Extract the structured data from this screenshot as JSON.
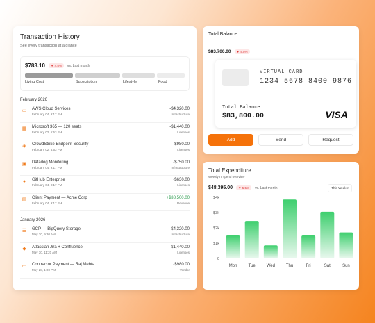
{
  "transaction_history": {
    "title": "Transaction History",
    "subtitle": "See every transaction at a glance",
    "summary": {
      "amount": "$783.10",
      "change": "▼ 4.5%",
      "comparison": "vs. Last month",
      "categories": [
        "Living Cost",
        "Subscription",
        "Lifestyle",
        "Food"
      ]
    },
    "groups": [
      {
        "month": "February 2026",
        "items": [
          {
            "icon": "server-icon",
            "glyph": "▭",
            "name": "AWS Cloud Services",
            "date": "February 04, 9:17 PM",
            "amount": "-$4,320.00",
            "category": "Infrastructure",
            "positive": false
          },
          {
            "icon": "apps-icon",
            "glyph": "▦",
            "name": "Microsoft 365 — 120 seats",
            "date": "February 02, 6:53 PM",
            "amount": "-$1,440.00",
            "category": "Licenses",
            "positive": false
          },
          {
            "icon": "shield-icon",
            "glyph": "◈",
            "name": "CrowdStrike Endpoint Security",
            "date": "February 02, 6:53 PM",
            "amount": "-$980.00",
            "category": "Licenses",
            "positive": false
          },
          {
            "icon": "monitor-icon",
            "glyph": "▣",
            "name": "Datadog Monitoring",
            "date": "February 04, 9:17 PM",
            "amount": "-$750.00",
            "category": "Infrastructure",
            "positive": false
          },
          {
            "icon": "github-icon",
            "glyph": "●",
            "name": "GitHub Enterprise",
            "date": "February 04, 9:17 PM",
            "amount": "-$630.00",
            "category": "Licenses",
            "positive": false
          },
          {
            "icon": "invoice-icon",
            "glyph": "▤",
            "name": "Client Payment — Acme Corp",
            "date": "February 04, 9:17 PM",
            "amount": "+$38,500.00",
            "category": "Revenue",
            "positive": true
          }
        ]
      },
      {
        "month": "January 2026",
        "items": [
          {
            "icon": "database-icon",
            "glyph": "☰",
            "name": "GCP — BigQuery Storage",
            "date": "May 30, 9:30 AM",
            "amount": "-$4,320.00",
            "category": "Infrastructure",
            "positive": false
          },
          {
            "icon": "layers-icon",
            "glyph": "◆",
            "name": "Atlassian Jira + Confluence",
            "date": "May 30, 11:20 AM",
            "amount": "-$1,440.00",
            "category": "Licenses",
            "positive": false
          },
          {
            "icon": "payment-icon",
            "glyph": "▭",
            "name": "Contractor Payment — Raj Mehta",
            "date": "May 28, 1:00 PM",
            "amount": "-$980.00",
            "category": "Vendor",
            "positive": false
          }
        ]
      }
    ]
  },
  "total_balance": {
    "title": "Total Balance",
    "amount": "$83,700.00",
    "change": "▼ 4.5%",
    "card": {
      "label": "VIRTUAL CARD",
      "number": "1234 5678 8400 9876",
      "balance_label": "Total Balance",
      "balance": "$83,800.00",
      "brand": "VISA"
    },
    "buttons": {
      "add": "Add",
      "send": "Send",
      "request": "Request"
    }
  },
  "total_expenditure": {
    "title": "Total Expenditure",
    "subtitle": "Weekly IT spend overview",
    "amount": "$48,395.00",
    "change": "▼ 5.5%",
    "comparison": "vs. Last month",
    "range_select": "This Week ▾"
  },
  "colors": {
    "accent": "#f5720a",
    "positive": "#2c9b4e",
    "negative": "#d33333",
    "bar": "#3ecf6e"
  },
  "chart_data": {
    "type": "bar",
    "categories": [
      "Mon",
      "Tue",
      "Wed",
      "Thu",
      "Fri",
      "Sat",
      "Sun"
    ],
    "values": [
      1500,
      2450,
      850,
      3850,
      1500,
      3050,
      1700
    ],
    "ylim": [
      0,
      4000
    ],
    "yticks": [
      "0",
      "$1k",
      "$2k",
      "$3k",
      "$4k"
    ],
    "xlabel": "",
    "ylabel": ""
  }
}
